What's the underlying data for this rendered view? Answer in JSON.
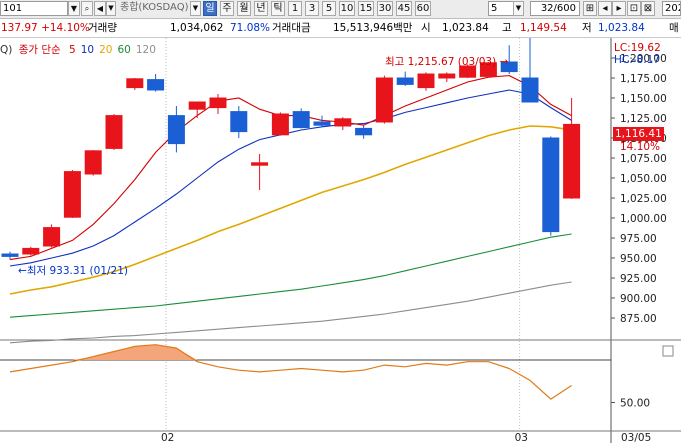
{
  "toolbar": {
    "code": "101",
    "name": "종합(KOSDAQ)",
    "periods": [
      "일",
      "주",
      "월",
      "년",
      "틱",
      "1",
      "3",
      "5",
      "10",
      "15",
      "30",
      "45",
      "60"
    ],
    "active_period": "일",
    "minute_value": "5",
    "count": "32/600",
    "date_fragment": "202"
  },
  "info": {
    "change": "137.97 +14.10%",
    "volume_label": "거래량",
    "volume": "1,034,062",
    "volume_pct": "71.08%",
    "amount_label": "거래대금",
    "amount": "15,513,946백만",
    "open_label": "시",
    "open": "1,023.84",
    "high_label": "고",
    "high": "1,149.54",
    "low_label": "저",
    "low": "1,023.84",
    "tail": "매"
  },
  "legend": {
    "prefix": "Q)",
    "title": "종가 단순",
    "ma": [
      {
        "label": "5",
        "color": "#d40000"
      },
      {
        "label": "10",
        "color": "#1030c0"
      },
      {
        "label": "20",
        "color": "#e0a800"
      },
      {
        "label": "60",
        "color": "#1a8c3a"
      },
      {
        "label": "120",
        "color": "#909090"
      }
    ]
  },
  "annotations": {
    "high": "최고 1,215.67 (03/03)",
    "low": "최저 933.31 (01/21)"
  },
  "right_labels": {
    "lc": "LC:19.62",
    "hc": "HC:-8.17",
    "current": "1,116.41",
    "pct": "14.10%",
    "indicator_tick": "50.00"
  },
  "colors": {
    "up": "#e8141b",
    "down": "#1a5fd4",
    "ma5": "#d40000",
    "ma10": "#1030c0",
    "ma20": "#e0a800",
    "ma60": "#1a8c3a",
    "ma120": "#8c8c8c",
    "osc": "#e07a1a"
  },
  "chart_data": {
    "type": "candlestick",
    "y_ticks": [
      "1,200.00",
      "1,175.00",
      "1,150.00",
      "1,125.00",
      "1,100.00",
      "1,075.00",
      "1,050.00",
      "1,025.00",
      "1,000.00",
      "975.00",
      "950.00",
      "925.00",
      "900.00",
      "875.00"
    ],
    "ylim": [
      850,
      1225
    ],
    "x_ticks": [
      {
        "label": "02",
        "index": 7.5
      },
      {
        "label": "03",
        "index": 24.5
      }
    ],
    "x_right_label": "03/05",
    "candles": [
      {
        "o": 955,
        "h": 958,
        "l": 948,
        "c": 952
      },
      {
        "o": 955,
        "h": 964,
        "l": 953,
        "c": 962
      },
      {
        "o": 965,
        "h": 992,
        "l": 963,
        "c": 988
      },
      {
        "o": 1001,
        "h": 1060,
        "l": 1000,
        "c": 1058
      },
      {
        "o": 1055,
        "h": 1085,
        "l": 1053,
        "c": 1084
      },
      {
        "o": 1087,
        "h": 1130,
        "l": 1085,
        "c": 1128
      },
      {
        "o": 1163,
        "h": 1175,
        "l": 1160,
        "c": 1174
      },
      {
        "o": 1173,
        "h": 1180,
        "l": 1158,
        "c": 1160
      },
      {
        "o": 1128,
        "h": 1140,
        "l": 1082,
        "c": 1093
      },
      {
        "o": 1136,
        "h": 1142,
        "l": 1125,
        "c": 1145
      },
      {
        "o": 1138,
        "h": 1155,
        "l": 1130,
        "c": 1150
      },
      {
        "o": 1133,
        "h": 1140,
        "l": 1100,
        "c": 1108
      },
      {
        "o": 1066,
        "h": 1080,
        "l": 1035,
        "c": 1069
      },
      {
        "o": 1104,
        "h": 1132,
        "l": 1103,
        "c": 1130
      },
      {
        "o": 1133,
        "h": 1137,
        "l": 1112,
        "c": 1113
      },
      {
        "o": 1120,
        "h": 1128,
        "l": 1114,
        "c": 1116
      },
      {
        "o": 1115,
        "h": 1126,
        "l": 1110,
        "c": 1124
      },
      {
        "o": 1112,
        "h": 1116,
        "l": 1099,
        "c": 1104
      },
      {
        "o": 1120,
        "h": 1178,
        "l": 1118,
        "c": 1175
      },
      {
        "o": 1175,
        "h": 1183,
        "l": 1165,
        "c": 1167
      },
      {
        "o": 1163,
        "h": 1182,
        "l": 1159,
        "c": 1180
      },
      {
        "o": 1175,
        "h": 1182,
        "l": 1170,
        "c": 1180
      },
      {
        "o": 1176,
        "h": 1192,
        "l": 1175,
        "c": 1190
      },
      {
        "o": 1177,
        "h": 1195,
        "l": 1176,
        "c": 1194
      },
      {
        "o": 1195,
        "h": 1216,
        "l": 1180,
        "c": 1183
      },
      {
        "o": 1175,
        "h": 1228,
        "l": 1145,
        "c": 1145
      },
      {
        "o": 1100,
        "h": 1102,
        "l": 978,
        "c": 983
      },
      {
        "o": 1025,
        "h": 1150,
        "l": 1024,
        "c": 1117
      }
    ],
    "ma5": [
      948,
      952,
      962,
      972,
      992,
      1018,
      1048,
      1082,
      1108,
      1128,
      1146,
      1150,
      1136,
      1128,
      1128,
      1122,
      1120,
      1116,
      1128,
      1140,
      1150,
      1160,
      1170,
      1176,
      1178,
      1165,
      1142,
      1128
    ],
    "ma10": [
      940,
      944,
      950,
      956,
      965,
      978,
      995,
      1012,
      1030,
      1050,
      1070,
      1086,
      1098,
      1104,
      1110,
      1114,
      1117,
      1118,
      1124,
      1132,
      1138,
      1144,
      1150,
      1155,
      1160,
      1155,
      1138,
      1122
    ],
    "ma20": [
      905,
      910,
      914,
      920,
      926,
      933,
      942,
      952,
      962,
      972,
      983,
      992,
      1002,
      1012,
      1022,
      1032,
      1040,
      1048,
      1057,
      1067,
      1076,
      1085,
      1094,
      1103,
      1110,
      1115,
      1114,
      1110
    ],
    "ma60": [
      876,
      878,
      880,
      882,
      884,
      886,
      888,
      890,
      893,
      896,
      899,
      902,
      905,
      908,
      911,
      915,
      919,
      923,
      928,
      934,
      940,
      946,
      952,
      958,
      964,
      970,
      976,
      980
    ],
    "ma120": [
      844,
      846,
      847,
      849,
      850,
      852,
      853,
      855,
      857,
      859,
      861,
      863,
      865,
      867,
      869,
      871,
      874,
      877,
      880,
      884,
      888,
      892,
      896,
      901,
      906,
      911,
      916,
      920
    ],
    "oscillator": {
      "ylim": [
        -80,
        20
      ],
      "values": [
        -14,
        -10,
        -6,
        -2,
        4,
        10,
        16,
        18,
        14,
        -2,
        -8,
        -12,
        -14,
        -12,
        -10,
        -12,
        -14,
        -12,
        -6,
        -8,
        -4,
        -6,
        -2,
        -2,
        -10,
        -24,
        -46,
        -30
      ]
    }
  }
}
